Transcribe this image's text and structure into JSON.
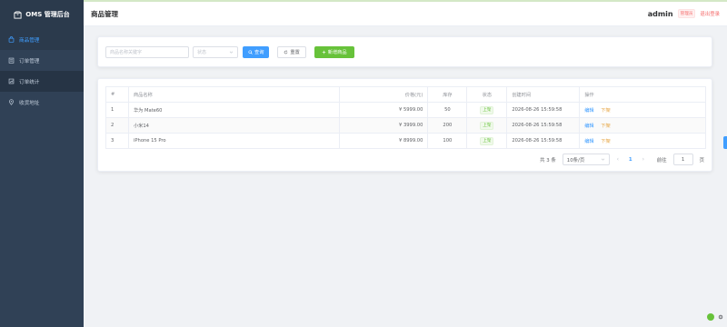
{
  "app": {
    "name": "OMS 管理后台"
  },
  "sidebar": {
    "items": [
      {
        "label": "商品管理",
        "icon": "shopping-bag-icon",
        "active": true
      },
      {
        "label": "订单管理",
        "icon": "clipboard-icon",
        "active": false
      },
      {
        "label": "订单统计",
        "icon": "chart-icon",
        "active": false
      },
      {
        "label": "收货地址",
        "icon": "location-icon",
        "active": false
      }
    ]
  },
  "header": {
    "title": "商品管理",
    "username": "admin",
    "role": "管理员",
    "logout": "退出登录"
  },
  "filters": {
    "keyword_placeholder": "商品名称关键字",
    "status_placeholder": "状态",
    "search_label": "查询",
    "reset_label": "重置",
    "add_label": "新增商品"
  },
  "table": {
    "columns": [
      "#",
      "商品名称",
      "价格(元)",
      "库存",
      "状态",
      "创建时间",
      "操作"
    ],
    "rows": [
      {
        "index": "1",
        "name": "华为 Mate60",
        "price": "¥ 5999.00",
        "stock": "50",
        "status": "上架",
        "created": "2026-08-26 15:59:58",
        "edit": "编辑",
        "toggle": "下架"
      },
      {
        "index": "2",
        "name": "小米14",
        "price": "¥ 3999.00",
        "stock": "200",
        "status": "上架",
        "created": "2026-08-26 15:59:58",
        "edit": "编辑",
        "toggle": "下架"
      },
      {
        "index": "3",
        "name": "iPhone 15 Pro",
        "price": "¥ 8999.00",
        "stock": "100",
        "status": "上架",
        "created": "2026-08-26 15:59:58",
        "edit": "编辑",
        "toggle": "下架"
      }
    ]
  },
  "pagination": {
    "total": "共 3 条",
    "page_size": "10条/页",
    "prev": "‹",
    "current": "1",
    "next": "›",
    "jump_label": "前往",
    "jump_value": "1",
    "page_unit": "页"
  },
  "colors": {
    "sidebar_bg": "#304156",
    "accent": "#409eff",
    "success": "#67c23a",
    "danger": "#f56c6c",
    "warning": "#e6a23c"
  }
}
